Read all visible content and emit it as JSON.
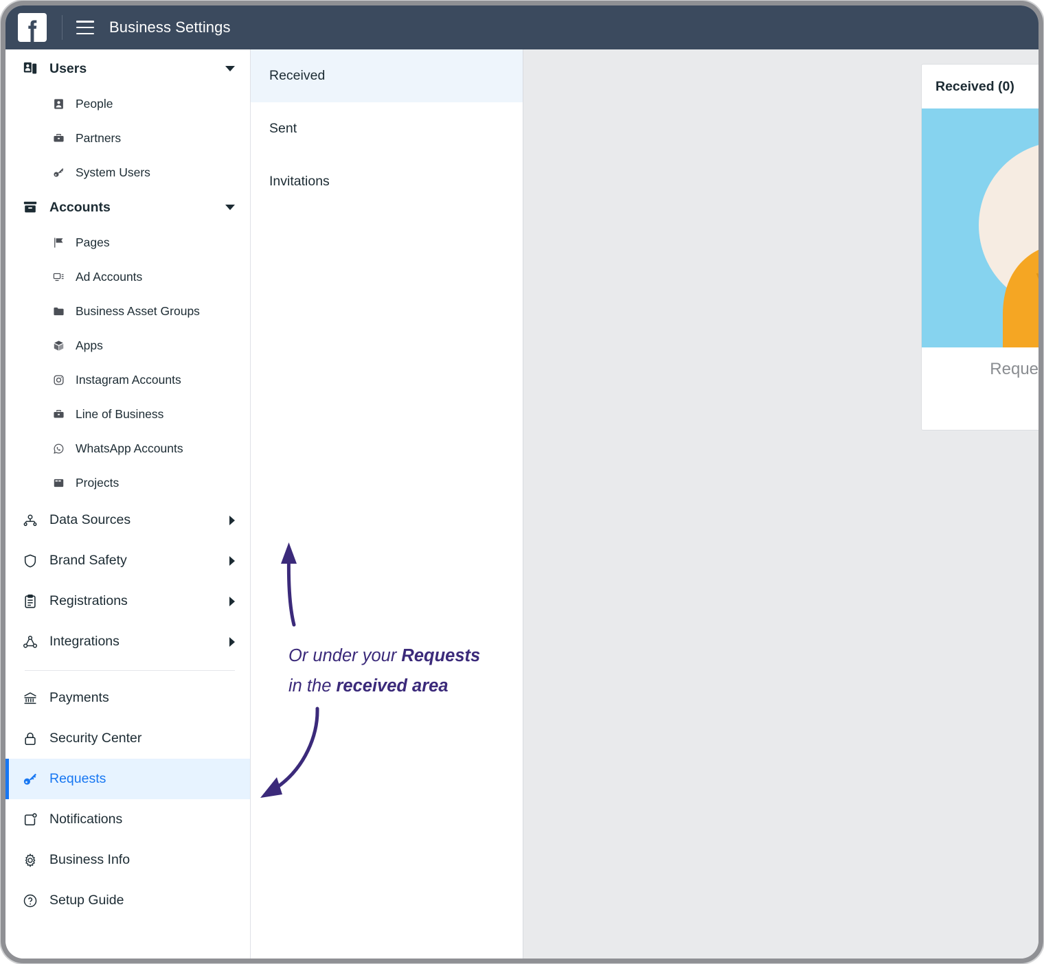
{
  "topbar": {
    "logo_icon": "facebook-logo-icon",
    "menu_icon": "hamburger-menu-icon",
    "title": "Business Settings"
  },
  "sidebar": {
    "groups": [
      {
        "label": "Users",
        "icon": "users-icon",
        "caret": "caret-down",
        "children": [
          {
            "label": "People",
            "icon": "person-icon"
          },
          {
            "label": "Partners",
            "icon": "briefcase-icon"
          },
          {
            "label": "System Users",
            "icon": "key-icon"
          }
        ]
      },
      {
        "label": "Accounts",
        "icon": "archive-box-icon",
        "caret": "caret-down",
        "children": [
          {
            "label": "Pages",
            "icon": "flag-icon"
          },
          {
            "label": "Ad Accounts",
            "icon": "ad-account-icon"
          },
          {
            "label": "Business Asset Groups",
            "icon": "folder-icon"
          },
          {
            "label": "Apps",
            "icon": "cube-icon"
          },
          {
            "label": "Instagram Accounts",
            "icon": "instagram-icon"
          },
          {
            "label": "Line of Business",
            "icon": "briefcase-icon"
          },
          {
            "label": "WhatsApp Accounts",
            "icon": "whatsapp-icon"
          },
          {
            "label": "Projects",
            "icon": "projects-icon"
          }
        ]
      }
    ],
    "collapsed_items": [
      {
        "label": "Data Sources",
        "icon": "data-sources-icon",
        "caret": "caret-right"
      },
      {
        "label": "Brand Safety",
        "icon": "shield-icon",
        "caret": "caret-right"
      },
      {
        "label": "Registrations",
        "icon": "clipboard-icon",
        "caret": "caret-right"
      },
      {
        "label": "Integrations",
        "icon": "integrations-icon",
        "caret": "caret-right"
      }
    ],
    "bottom_items": [
      {
        "label": "Payments",
        "icon": "bank-icon",
        "active": false
      },
      {
        "label": "Security Center",
        "icon": "lock-icon",
        "active": false
      },
      {
        "label": "Requests",
        "icon": "key-icon",
        "active": true
      },
      {
        "label": "Notifications",
        "icon": "notifications-icon",
        "active": false
      },
      {
        "label": "Business Info",
        "icon": "gear-icon",
        "active": false
      },
      {
        "label": "Setup Guide",
        "icon": "question-circle-icon",
        "active": false
      }
    ]
  },
  "subnav": {
    "items": [
      {
        "label": "Received",
        "active": true
      },
      {
        "label": "Sent",
        "active": false
      },
      {
        "label": "Invitations",
        "active": false
      }
    ]
  },
  "annotation": {
    "line1_plain": "Or under your ",
    "line1_bold": "Requests",
    "line2_plain": "in the ",
    "line2_bold": "received area",
    "color": "#3b2a7a",
    "arrows": [
      "curved-arrow-up-icon",
      "curved-arrow-down-left-icon"
    ]
  },
  "card": {
    "title": "Received (0)",
    "illustration": "person-orange-hoodie-illustration",
    "footer_text": "Requests",
    "colors": {
      "illustration_bg": "#86d3ef",
      "circle": "#f6ece2",
      "hoodie": "#f5a623",
      "skin": "#6b6570",
      "hair": "#1c1c1c"
    }
  },
  "colors": {
    "topbar_bg": "#3b4a5e",
    "accent_blue": "#1877f2",
    "active_row_bg": "#e7f3ff",
    "content_bg": "#e9eaec",
    "annotation_purple": "#3b2a7a"
  }
}
